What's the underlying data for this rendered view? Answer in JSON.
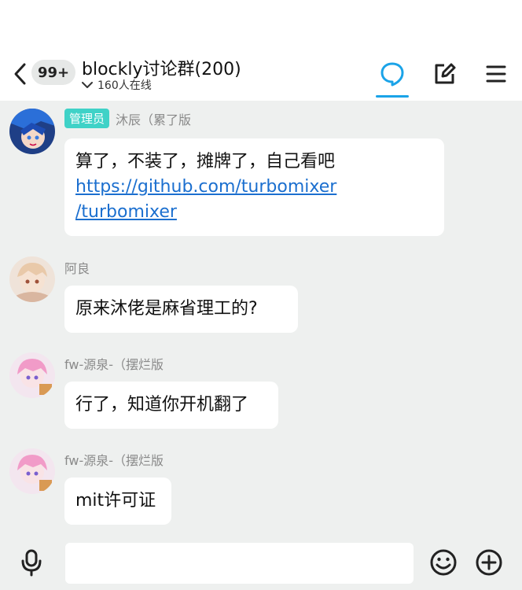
{
  "header": {
    "unread_count": "99+",
    "title": "blockly讨论群(200)",
    "online_status": "160人在线"
  },
  "messages": [
    {
      "role": "管理员",
      "sender": "沐辰（累了版",
      "text": "算了，不装了，摊牌了，自己看吧",
      "link": "https://github.com/turbomixer/turbomixer",
      "link_line1": "https://github.com/turbomixer",
      "link_line2": "/turbomixer"
    },
    {
      "sender": "阿良",
      "text": "原来沐佬是麻省理工的?"
    },
    {
      "sender": "fw-源泉-（摆烂版",
      "text": "行了，知道你开机翻了"
    },
    {
      "sender": "fw-源泉-（摆烂版",
      "text": "mit许可证"
    }
  ],
  "input_bar": {
    "value": ""
  },
  "colors": {
    "accent": "#1aa3e8",
    "link": "#1b6fcf",
    "admin_badge": "#3fd2c7",
    "background": "#eef0ef"
  }
}
